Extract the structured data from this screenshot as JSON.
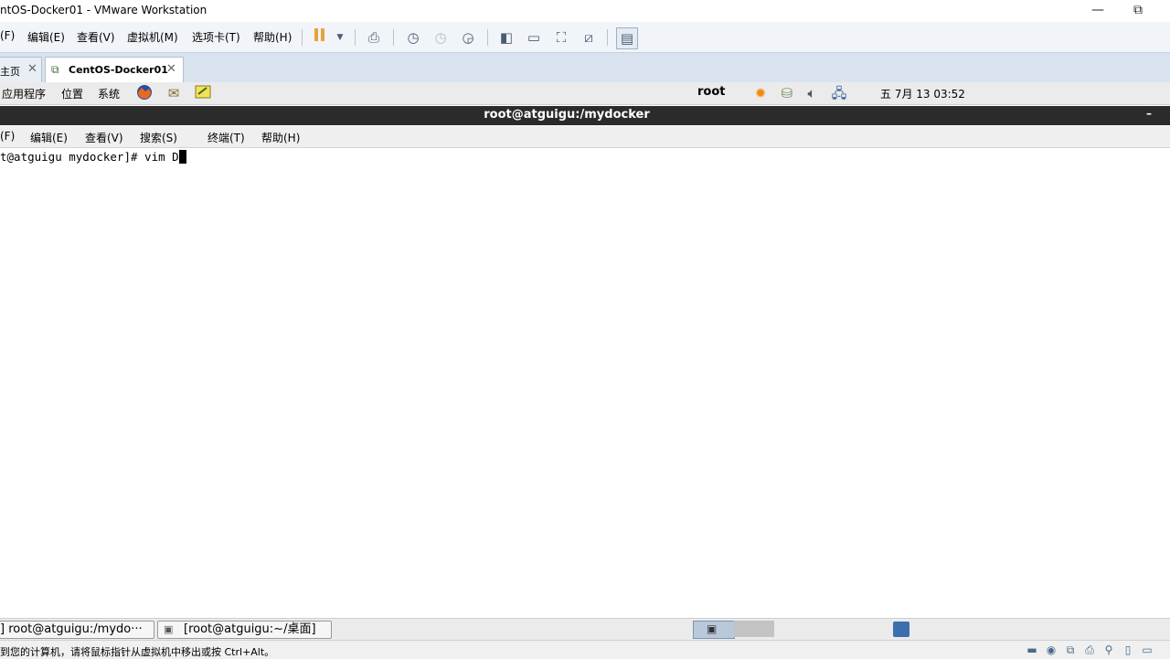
{
  "vmware": {
    "window_title": "ntOS-Docker01 - VMware Workstation",
    "window_buttons": {
      "minimize": "—",
      "restore": "⧉"
    },
    "menu": [
      "(F)",
      "编辑(E)",
      "查看(V)",
      "虚拟机(M)",
      "选项卡(T)",
      "帮助(H)"
    ],
    "toolbar_icons": [
      "pause-icon",
      "dropdown-icon",
      "send-keys-icon",
      "snapshot-icon",
      "revert-snapshot-icon",
      "snapshot-manager-icon",
      "sidebar-icon",
      "console-view-icon",
      "fullscreen-icon",
      "unity-icon",
      "thumbnail-icon"
    ],
    "tabs": [
      {
        "label": "主页",
        "close": "✕"
      },
      {
        "label": "CentOS-Docker01",
        "close": "✕"
      }
    ]
  },
  "gnome": {
    "menus": [
      "应用程序",
      "位置",
      "系统"
    ],
    "user": "root",
    "clock": "五 7月 13 03:52"
  },
  "terminal": {
    "title": "root@atguigu:/mydocker",
    "title_min": "–",
    "menu": [
      "(F)",
      "编辑(E)",
      "查看(V)",
      "搜索(S)",
      "终端(T)",
      "帮助(H)"
    ],
    "prompt": "t@atguigu mydocker]# vim D"
  },
  "taskbar": {
    "items": [
      "] root@atguigu:/mydo···",
      "[root@atguigu:~/桌面]"
    ]
  },
  "statusbar": {
    "text": "到您的计算机，请将鼠标指针从虚拟机中移出或按 Ctrl+Alt。"
  },
  "colors": {
    "terminal_title_bg": "#2b2b2b",
    "vmware_menu_bg": "#f1f4f8",
    "tab_strip_bg": "#d9e3ef",
    "pause_accent": "#e8a33c"
  }
}
